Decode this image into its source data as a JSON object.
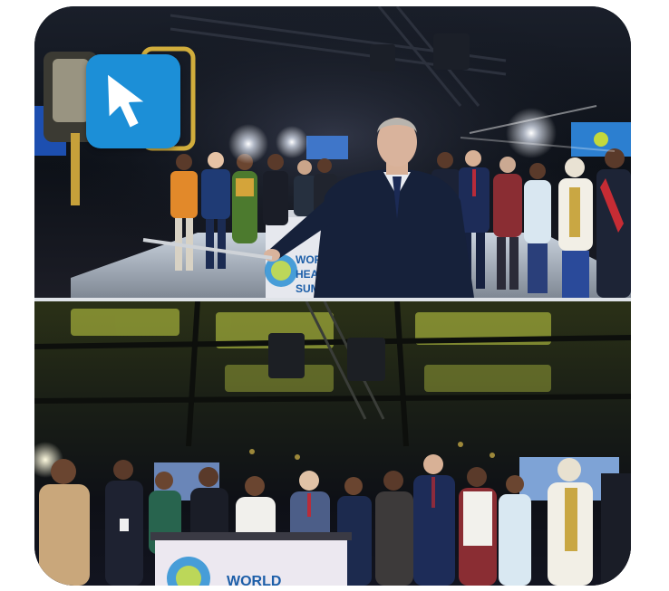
{
  "top_photo": {
    "sign_line1": "WORLD",
    "sign_line2": "HEALTH",
    "sign_line3": "SUMMIT"
  },
  "bottom_photo": {
    "sign_line1": "WORLD"
  },
  "cursor_badge": {
    "icon": "mouse-pointer-icon",
    "color": "#1c8fd7"
  }
}
